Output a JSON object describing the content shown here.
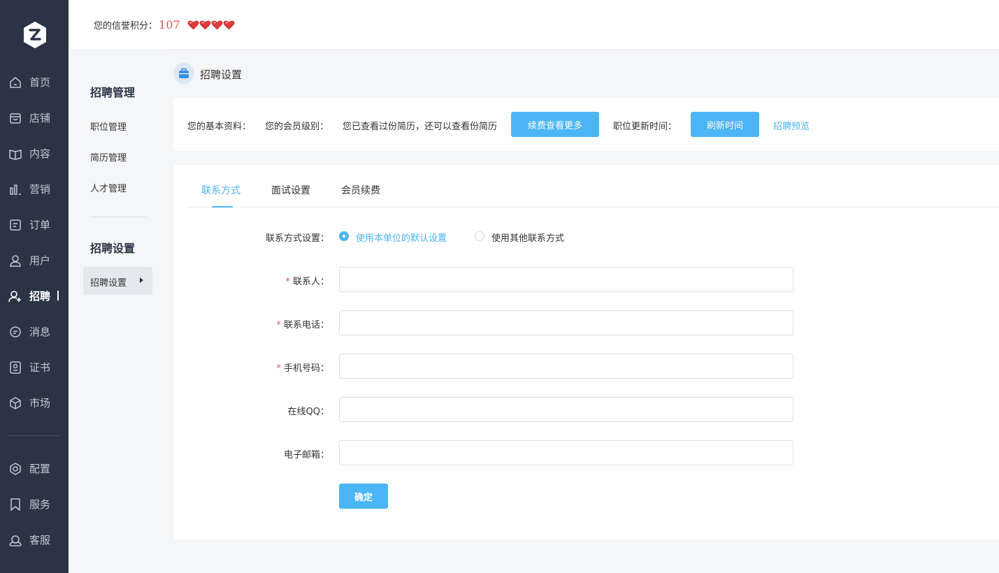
{
  "colors": {
    "accent": "#4cb5f5",
    "sidebar": "#2b3445",
    "danger": "#e05454"
  },
  "header": {
    "credit_label": "您的信誉积分：",
    "credit_score": "107",
    "hearts": 4
  },
  "nav": {
    "items": [
      {
        "label": "首页",
        "icon": "home-icon"
      },
      {
        "label": "店铺",
        "icon": "shop-icon"
      },
      {
        "label": "内容",
        "icon": "book-icon"
      },
      {
        "label": "营销",
        "icon": "bar-chart-icon"
      },
      {
        "label": "订单",
        "icon": "order-icon"
      },
      {
        "label": "用户",
        "icon": "user-icon"
      },
      {
        "label": "招聘",
        "icon": "user-add-icon",
        "active": true
      },
      {
        "label": "消息",
        "icon": "message-icon"
      },
      {
        "label": "证书",
        "icon": "certificate-icon"
      },
      {
        "label": "市场",
        "icon": "cube-icon"
      },
      {
        "label": "配置",
        "icon": "gear-icon"
      },
      {
        "label": "服务",
        "icon": "bookmark-icon"
      },
      {
        "label": "客服",
        "icon": "headset-icon"
      }
    ]
  },
  "subnav": {
    "group1_title": "招聘管理",
    "group1_items": [
      "职位管理",
      "简历管理",
      "人才管理"
    ],
    "group2_title": "招聘设置",
    "active_item": "招聘设置"
  },
  "page": {
    "title": "招聘设置"
  },
  "info": {
    "basic": "您的基本资料：",
    "level": "您的会员级别：",
    "views": "您已查看过份简历，还可以查看份简历",
    "renew_button": "续费查看更多",
    "update_time": "职位更新时间：",
    "refresh_button": "刷新时间",
    "preview_link": "招聘预览"
  },
  "tabs": [
    "联系方式",
    "面试设置",
    "会员续费"
  ],
  "form": {
    "contact_setting_label": "联系方式设置：",
    "radio_default": "使用本单位的默认设置",
    "radio_other": "使用其他联系方式",
    "contact_person": "联系人：",
    "phone": "联系电话：",
    "mobile": "手机号码：",
    "qq": "在线QQ：",
    "email": "电子邮箱：",
    "required_mark": "*",
    "submit": "确定"
  }
}
